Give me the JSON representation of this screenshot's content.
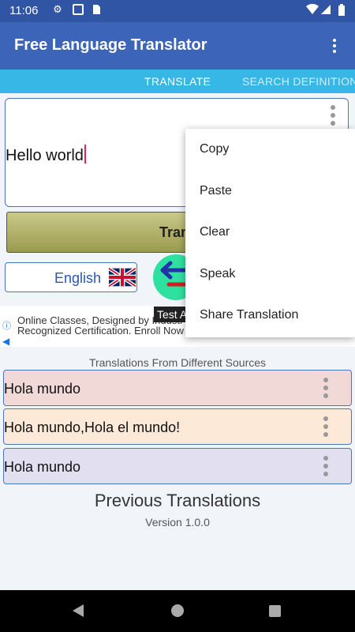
{
  "status_bar": {
    "time": "11:06",
    "icons": [
      "settings-icon",
      "sim-icon",
      "sd-card-icon",
      "wifi-icon",
      "signal-icon",
      "battery-icon"
    ]
  },
  "app_bar": {
    "title": "Free Language Translator",
    "menu_icon": "more-vert-icon"
  },
  "tabs": [
    {
      "label": "TRANSLATE",
      "active": true
    },
    {
      "label": "SEARCH DEFINITION",
      "active": false
    }
  ],
  "input": {
    "value": "Hello world"
  },
  "translate_button": {
    "label": "Trans"
  },
  "source_language": {
    "label": "English",
    "flag_icon": "uk-flag-icon"
  },
  "swap_icon": "arrow-left-icon",
  "ad": {
    "line1": "Online Classes, Designed by Industr",
    "line2": "Recognized Certification. Enroll Now",
    "test_label": "Test A"
  },
  "sources_label": "Translations From Different Sources",
  "results": [
    {
      "text": "Hola mundo",
      "color": "#f1d9d7"
    },
    {
      "text": "Hola mundo,Hola el mundo!",
      "color": "#fde9d8"
    },
    {
      "text": "Hola mundo",
      "color": "#e1dff0"
    }
  ],
  "previous_title": "Previous Translations",
  "version": "Version 1.0.0",
  "context_menu": [
    "Copy",
    "Paste",
    "Clear",
    "Speak",
    "Share Translation"
  ],
  "colors": {
    "status_bar": "#2f55a4",
    "app_bar": "#3c64b8",
    "tabs": "#37b7e6",
    "swap": "#2fe1a0",
    "accent": "#e91e63"
  }
}
